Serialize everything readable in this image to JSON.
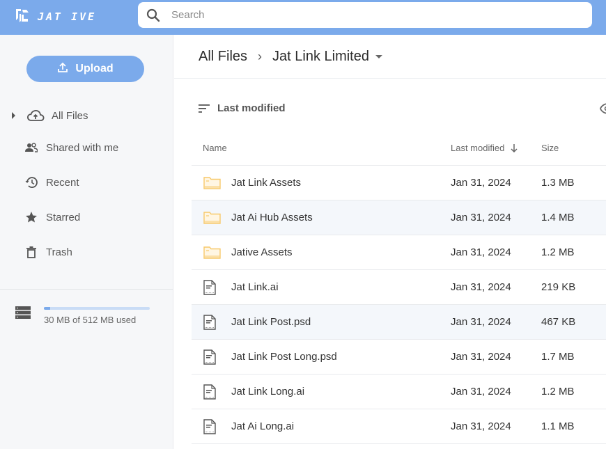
{
  "app": {
    "logo_text": "JAT IVE",
    "brand_color": "#7baaeb"
  },
  "search": {
    "placeholder": "Search",
    "value": ""
  },
  "sidebar": {
    "upload_label": "Upload",
    "items": [
      {
        "label": "All Files",
        "icon": "cloud-upload-icon"
      },
      {
        "label": "Shared with me",
        "icon": "people-icon"
      },
      {
        "label": "Recent",
        "icon": "history-icon"
      },
      {
        "label": "Starred",
        "icon": "star-icon"
      },
      {
        "label": "Trash",
        "icon": "trash-icon"
      }
    ],
    "storage": {
      "label": "30 MB of 512 MB used",
      "used_mb": 30,
      "total_mb": 512
    }
  },
  "main": {
    "breadcrumb": {
      "root": "All Files",
      "current": "Jat Link Limited"
    },
    "sort_label": "Last modified",
    "columns": {
      "name": "Name",
      "date": "Last modified",
      "size": "Size"
    },
    "rows": [
      {
        "name": "Jat Link Assets",
        "type": "folder",
        "date": "Jan 31, 2024",
        "size": "1.3 MB"
      },
      {
        "name": "Jat Ai Hub Assets",
        "type": "folder",
        "date": "Jan 31, 2024",
        "size": "1.4 MB"
      },
      {
        "name": "Jative Assets",
        "type": "folder",
        "date": "Jan 31, 2024",
        "size": "1.2 MB"
      },
      {
        "name": "Jat Link.ai",
        "type": "file",
        "date": "Jan 31, 2024",
        "size": "219 KB"
      },
      {
        "name": "Jat Link Post.psd",
        "type": "file",
        "date": "Jan 31, 2024",
        "size": "467 KB"
      },
      {
        "name": "Jat Link Post Long.psd",
        "type": "file",
        "date": "Jan 31, 2024",
        "size": "1.7 MB"
      },
      {
        "name": "Jat Link Long.ai",
        "type": "file",
        "date": "Jan 31, 2024",
        "size": "1.2 MB"
      },
      {
        "name": "Jat Ai Long.ai",
        "type": "file",
        "date": "Jan 31, 2024",
        "size": "1.1 MB"
      }
    ]
  }
}
